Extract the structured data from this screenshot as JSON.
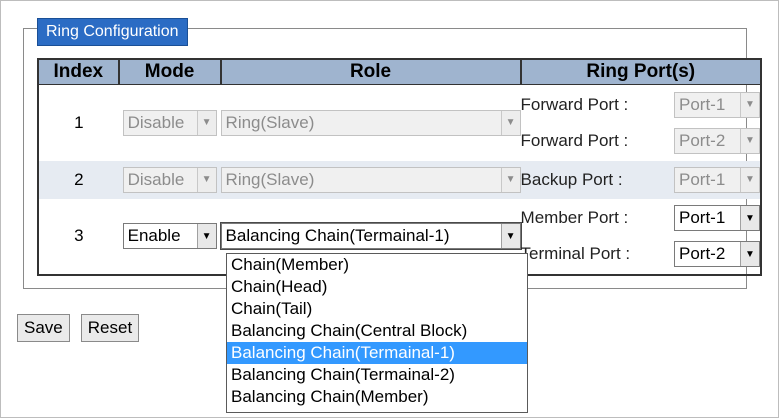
{
  "legend": "Ring Configuration",
  "headers": [
    "Index",
    "Mode",
    "Role",
    "Ring Port(s)"
  ],
  "rows": [
    {
      "index": "1",
      "mode": "Disable",
      "role": "Ring(Slave)",
      "ports": [
        {
          "label": "Forward Port :",
          "value": "Port-1"
        },
        {
          "label": "Forward Port :",
          "value": "Port-2"
        }
      ]
    },
    {
      "index": "2",
      "mode": "Disable",
      "role": "Ring(Slave)",
      "ports": [
        {
          "label": "Backup Port :",
          "value": "Port-1"
        }
      ]
    },
    {
      "index": "3",
      "mode": "Enable",
      "role": "Balancing Chain(Termainal-1)",
      "ports": [
        {
          "label": "Member Port :",
          "value": "Port-1"
        },
        {
          "label": "Terminal Port :",
          "value": "Port-2"
        }
      ]
    }
  ],
  "role_dropdown": {
    "options": [
      "Chain(Member)",
      "Chain(Head)",
      "Chain(Tail)",
      "Balancing Chain(Central Block)",
      "Balancing Chain(Termainal-1)",
      "Balancing Chain(Termainal-2)",
      "Balancing Chain(Member)"
    ],
    "selected_index": 4
  },
  "buttons": {
    "save": "Save",
    "reset": "Reset"
  },
  "icons": {
    "dropdown_arrow": "chevron-down-icon"
  },
  "colors": {
    "legend_bg": "#2b6cc4",
    "header_bg": "#9fb4cf",
    "row_alt": "#e6ebf2",
    "selected": "#3399ff"
  }
}
